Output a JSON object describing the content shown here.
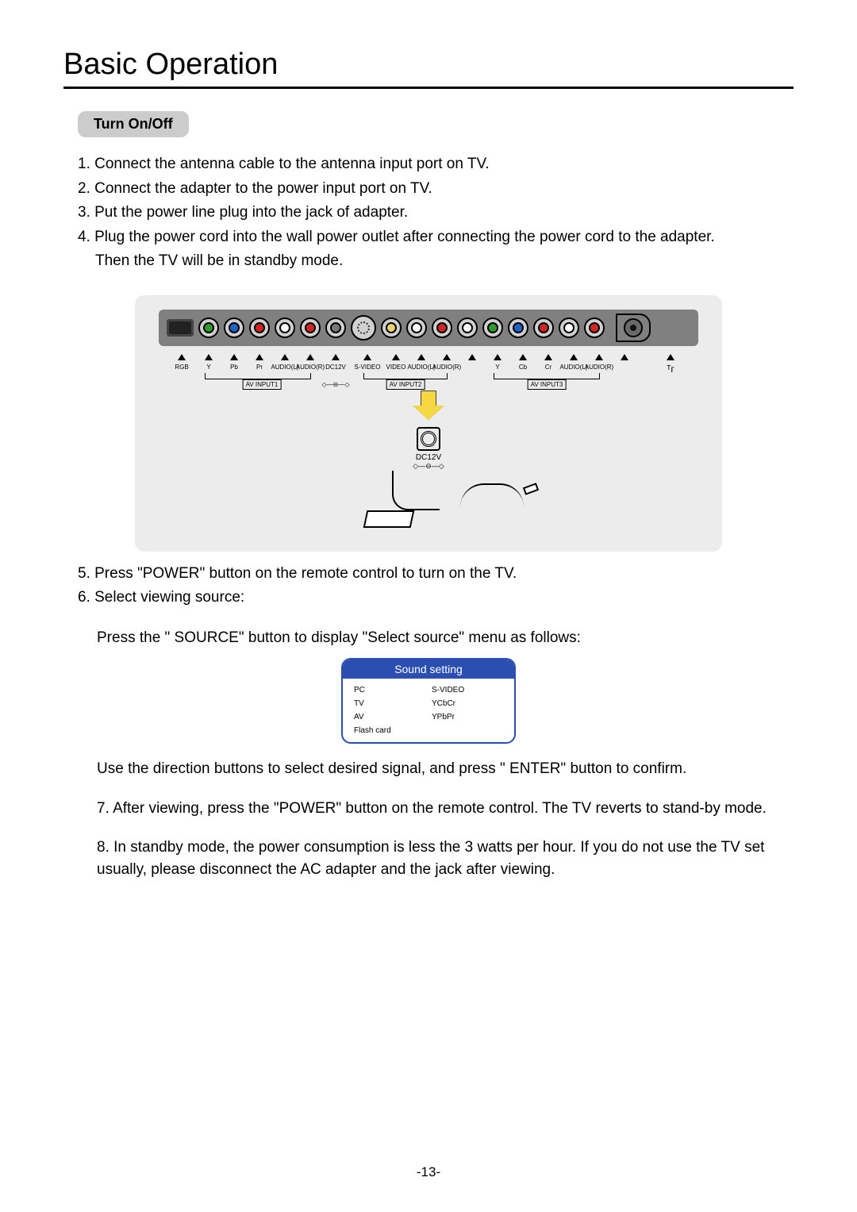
{
  "title": "Basic Operation",
  "section_label": "Turn On/Off",
  "steps": {
    "s1": "1. Connect the antenna cable to the antenna input port on TV.",
    "s2": "2. Connect the adapter to the power input port on TV.",
    "s3": "3. Put the power line plug into the jack of adapter.",
    "s4a": "4. Plug the power cord into the wall power outlet after connecting the power cord to the adapter.",
    "s4b": "Then the TV will be in standby mode.",
    "s5": "5. Press \"POWER\" button on the remote control to turn on the TV.",
    "s6": "6. Select viewing source:",
    "s6a": "Press the \" SOURCE\" button to display \"Select source\" menu as follows:",
    "s6b": "Use the direction buttons to select desired signal, and press \" ENTER\" button to confirm.",
    "s7": "7. After viewing, press the \"POWER\" button on the remote control. The TV reverts to stand-by mode.",
    "s8": "8. In standby mode, the power consumption is less the 3 watts per hour. If you do not use the TV set usually, please disconnect the AC adapter and the jack after viewing."
  },
  "panel": {
    "labels": {
      "rgb": "RGB",
      "y": "Y",
      "pb": "Pb",
      "pr": "Pr",
      "al": "AUDIO(L)",
      "ar": "AUDIO(R)",
      "dc": "DC12V",
      "sv": "S-VIDEO",
      "vid": "VIDEO",
      "cb": "Cb",
      "cr": "Cr",
      "in1": "AV INPUT1",
      "in2": "AV INPUT2",
      "in3": "AV INPUT3",
      "ant": "ᵀᴦ"
    },
    "dc_label": "DC12V",
    "dc_sym": "◇—⊖—◇"
  },
  "menu": {
    "title": "Sound setting",
    "col1": [
      "PC",
      "TV",
      "AV",
      "Flash card"
    ],
    "col2": [
      "S-VIDEO",
      "YCbCr",
      "YPbPr"
    ]
  },
  "page_number": "-13-"
}
